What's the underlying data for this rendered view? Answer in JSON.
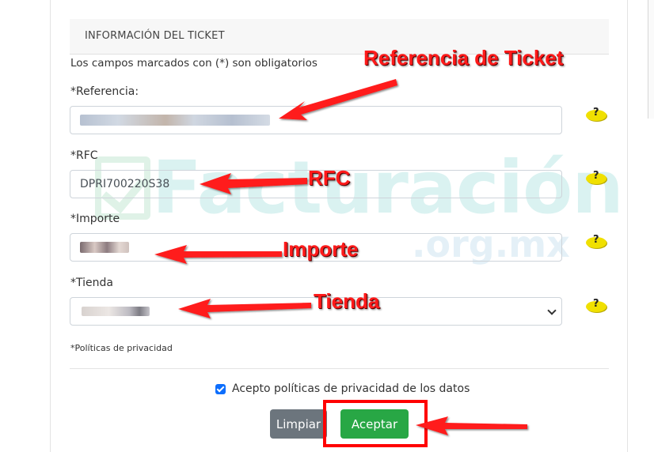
{
  "card": {
    "header_title": "INFORMACIÓN DEL TICKET",
    "required_note": "Los campos marcados con (*) son obligatorios"
  },
  "fields": {
    "referencia": {
      "label": "*Referencia:",
      "value_redacted": true
    },
    "rfc": {
      "label": "*RFC",
      "value": "DPRI700220S38"
    },
    "importe": {
      "label": "*Importe",
      "value_redacted": true
    },
    "tienda": {
      "label": "*Tienda",
      "value_redacted": true
    }
  },
  "help_icon_glyph": "?",
  "privacy_link": "*Políticas de privacidad",
  "consent": {
    "checked": true,
    "label": "Acepto políticas de privacidad de los datos"
  },
  "buttons": {
    "clear": "Limpiar",
    "accept": "Aceptar"
  },
  "annotations": {
    "referencia": "Referencia de Ticket",
    "rfc": "RFC",
    "importe": "Importe",
    "tienda": "Tienda"
  },
  "watermark": {
    "word": "Facturación",
    "domain": ".org.mx"
  },
  "colors": {
    "accept_button": "#28a745",
    "clear_button": "#6c757d",
    "annotation_red": "#ff1a1a",
    "help_icon": "#f0e000",
    "checkbox": "#0d6efd"
  }
}
